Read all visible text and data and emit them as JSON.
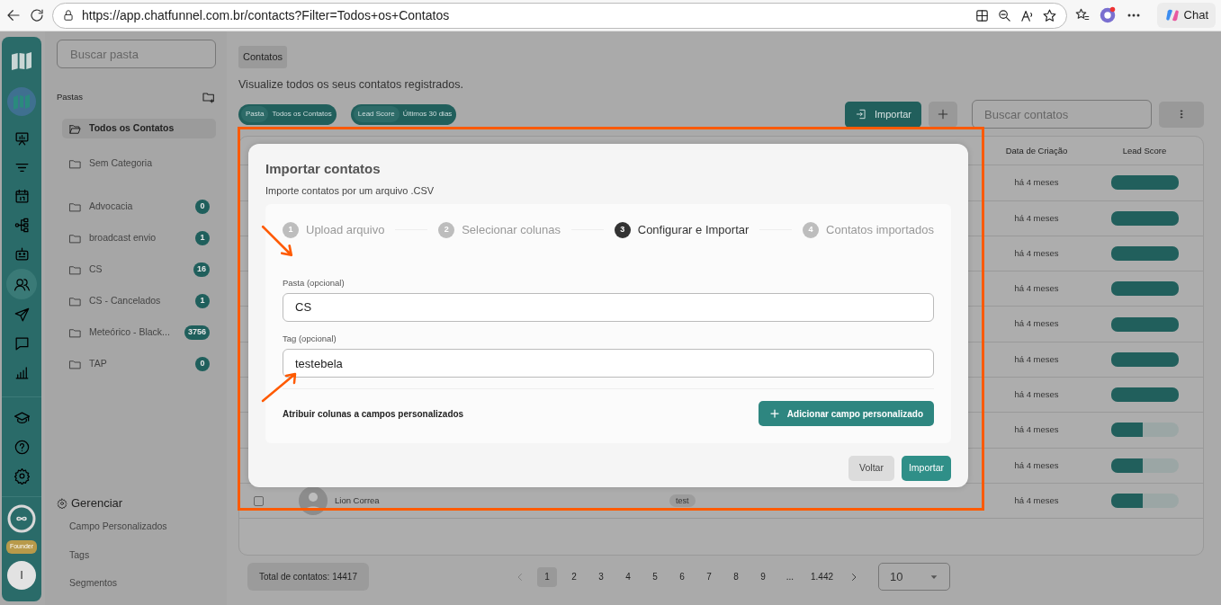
{
  "browser": {
    "url": "https://app.chatfunnel.com.br/contacts?Filter=Todos+os+Contatos",
    "chat_label": "Chat"
  },
  "rail": {
    "items": [
      {
        "kind": "dashboard",
        "selected": false
      },
      {
        "kind": "filter",
        "selected": false
      },
      {
        "kind": "calendar",
        "selected": false
      },
      {
        "kind": "flow",
        "selected": false
      },
      {
        "kind": "bot",
        "selected": false
      },
      {
        "kind": "contacts",
        "selected": true
      },
      {
        "kind": "send",
        "selected": false
      },
      {
        "kind": "chat",
        "selected": false
      },
      {
        "kind": "chart",
        "selected": false
      }
    ],
    "bottom_items": [
      {
        "kind": "learn",
        "selected": false
      },
      {
        "kind": "help",
        "selected": false
      },
      {
        "kind": "settings",
        "selected": false
      }
    ],
    "badge": "Founder",
    "user_initial": "I"
  },
  "sidebar": {
    "search_placeholder": "Buscar pasta",
    "section_label": "Pastas",
    "pinned_folders": [
      {
        "name": "Todos os Contatos",
        "selected": true
      },
      {
        "name": "Sem Categoria",
        "selected": false
      }
    ],
    "folders": [
      {
        "name": "Advocacia",
        "count": "0",
        "selected": false
      },
      {
        "name": "broadcast envio",
        "count": "1",
        "selected": false
      },
      {
        "name": "CS",
        "count": "16",
        "selected": false
      },
      {
        "name": "CS - Cancelados",
        "count": "1",
        "selected": false
      },
      {
        "name": "Meteórico - Black...",
        "count": "3756",
        "selected": false
      },
      {
        "name": "TAP",
        "count": "0",
        "selected": false
      }
    ],
    "manage_title": "Gerenciar",
    "manage_links": [
      "Campo Personalizados",
      "Tags",
      "Segmentos"
    ]
  },
  "page": {
    "title": "Contatos",
    "description": "Visualize todos os seus contatos registrados.",
    "filters": [
      {
        "label": "Pasta",
        "value": "Todos os Contatos"
      },
      {
        "label": "Lead Score",
        "value": "Últimos 30 dias"
      }
    ],
    "import_button": "Importar",
    "search_placeholder": "Buscar contatos"
  },
  "table": {
    "columns": [
      "Data de Criação",
      "Lead Score"
    ],
    "rows": [
      {
        "created": "há 4 meses",
        "level": 1
      },
      {
        "created": "há 4 meses",
        "level": 1
      },
      {
        "created": "há 4 meses",
        "level": 1
      },
      {
        "created": "há 4 meses",
        "level": 1
      },
      {
        "created": "há 4 meses",
        "level": 1
      },
      {
        "created": "há 4 meses",
        "level": 1
      },
      {
        "created": "há 4 meses",
        "level": 1
      },
      {
        "created": "há 4 meses",
        "level": 0.47
      },
      {
        "created": "há 4 meses",
        "level": 0.47
      },
      {
        "name": "Lion Correa",
        "tag": "test",
        "checked": false,
        "created": "há 4 meses",
        "level": 0.47
      }
    ]
  },
  "footer": {
    "total": "Total de contatos: 14417",
    "pages": [
      {
        "label": "1",
        "selected": true
      },
      {
        "label": "2",
        "selected": false
      },
      {
        "label": "3",
        "selected": false
      },
      {
        "label": "4",
        "selected": false
      },
      {
        "label": "5",
        "selected": false
      },
      {
        "label": "6",
        "selected": false
      },
      {
        "label": "7",
        "selected": false
      },
      {
        "label": "8",
        "selected": false
      },
      {
        "label": "9",
        "selected": false
      },
      {
        "label": "...",
        "selected": false
      },
      {
        "label": "1.442",
        "selected": false
      }
    ],
    "page_size": "10"
  },
  "modal": {
    "title": "Importar contatos",
    "subtitle": "Importe contatos por um arquivo .CSV",
    "steps": [
      {
        "number": "1",
        "label": "Upload arquivo",
        "selected": false
      },
      {
        "number": "2",
        "label": "Selecionar colunas",
        "selected": false
      },
      {
        "number": "3",
        "label": "Configurar e Importar",
        "selected": true
      },
      {
        "number": "4",
        "label": "Contatos importados",
        "selected": false
      }
    ],
    "fields": [
      {
        "label": "Pasta (opcional)",
        "value": "CS"
      },
      {
        "label": "Tag (opcional)",
        "value": "testebela"
      }
    ],
    "custom_fields_label": "Atribuir colunas a campos personalizados",
    "add_button": "Adicionar campo personalizado",
    "back_button": "Voltar",
    "import_button": "Importar"
  }
}
